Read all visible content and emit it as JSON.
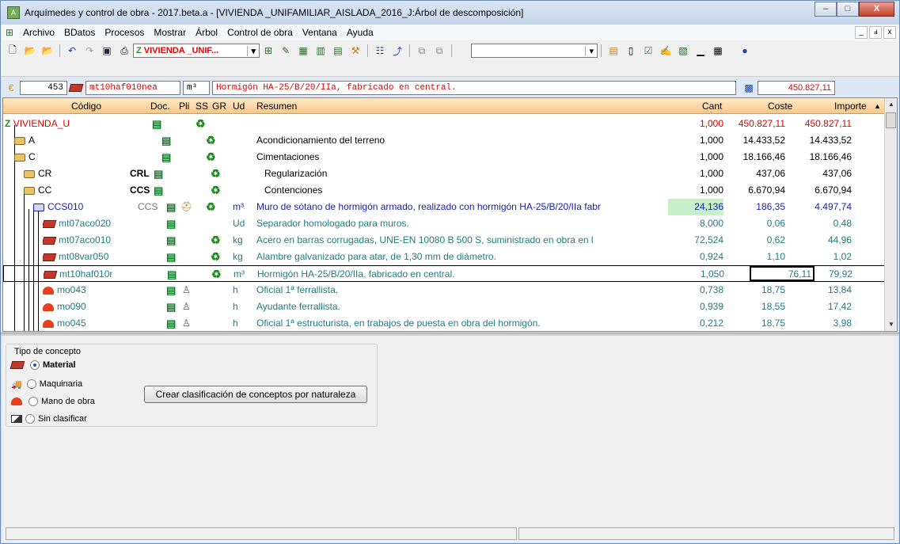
{
  "window": {
    "title": "Arquímedes y control de obra - 2017.beta.a - [VIVIENDA _UNIFAMILIAR_AISLADA_2016_J:Árbol de descomposición]",
    "controls": [
      "–",
      "□",
      "X"
    ]
  },
  "menu": {
    "items": [
      "Archivo",
      "BDatos",
      "Procesos",
      "Mostrar",
      "Árbol",
      "Control de obra",
      "Ventana",
      "Ayuda"
    ],
    "mdi_controls": [
      "_",
      "ⅎ",
      "x"
    ]
  },
  "toolbar": {
    "project_combo": "VIVIENDA _UNIF...",
    "empty_combo": ""
  },
  "infobar": {
    "count": "453",
    "code": "mt10haf010nea",
    "unit": "m³",
    "summary": "Hormigón HA-25/B/20/IIa, fabricado en central.",
    "total": "450.827,11"
  },
  "grid": {
    "headers": {
      "codigo": "Código",
      "doc": "Doc.",
      "pli": "Pli",
      "ss": "SS",
      "gr": "GR",
      "ud": "Ud",
      "resumen": "Resumen",
      "cant": "Cant",
      "coste": "Coste",
      "importe": "Importe"
    },
    "rows": [
      {
        "code": "VIVIENDA_U",
        "code2": "",
        "ud": "",
        "resumen": "",
        "cant": "1,000",
        "coste": "450.827,11",
        "importe": "450.827,11"
      },
      {
        "code": "A",
        "code2": "",
        "ud": "",
        "resumen": "Acondicionamiento del terreno",
        "cant": "1,000",
        "coste": "14.433,52",
        "importe": "14.433,52"
      },
      {
        "code": "C",
        "code2": "",
        "ud": "",
        "resumen": "Cimentaciones",
        "cant": "1,000",
        "coste": "18.166,46",
        "importe": "18.166,46"
      },
      {
        "code": "CR",
        "code2": "CRL",
        "ud": "",
        "resumen": "Regularización",
        "cant": "1,000",
        "coste": "437,06",
        "importe": "437,06"
      },
      {
        "code": "CC",
        "code2": "CCS",
        "ud": "",
        "resumen": "Contenciones",
        "cant": "1,000",
        "coste": "6.670,94",
        "importe": "6.670,94"
      },
      {
        "code": "CCS010",
        "code2": "CCS",
        "ud": "m³",
        "resumen": "Muro de sótano de hormigón armado, realizado con hormigón HA-25/B/20/IIa fabr",
        "cant": "24,136",
        "coste": "186,35",
        "importe": "4.497,74"
      },
      {
        "code": "mt07aco020",
        "code2": "",
        "ud": "Ud",
        "resumen": "Separador homologado para muros.",
        "cant": "8,000",
        "coste": "0,06",
        "importe": "0,48"
      },
      {
        "code": "mt07aco010",
        "code2": "",
        "ud": "kg",
        "resumen": "Acero en barras corrugadas, UNE-EN 10080 B 500 S, suministrado en obra en l",
        "cant": "72,524",
        "coste": "0,62",
        "importe": "44,96"
      },
      {
        "code": "mt08var050",
        "code2": "",
        "ud": "kg",
        "resumen": "Alambre galvanizado para atar, de 1,30 mm de diámetro.",
        "cant": "0,924",
        "coste": "1,10",
        "importe": "1,02"
      },
      {
        "code": "mt10haf010r",
        "code2": "",
        "ud": "m³",
        "resumen": "Hormigón HA-25/B/20/IIa, fabricado en central.",
        "cant": "1,050",
        "coste": "76,11",
        "importe": "79,92"
      },
      {
        "code": "mo043",
        "code2": "",
        "ud": "h",
        "resumen": "Oficial 1ª ferrallista.",
        "cant": "0,738",
        "coste": "18,75",
        "importe": "13,84"
      },
      {
        "code": "mo090",
        "code2": "",
        "ud": "h",
        "resumen": "Ayudante ferrallista.",
        "cant": "0,939",
        "coste": "18,55",
        "importe": "17,42"
      },
      {
        "code": "mo045",
        "code2": "",
        "ud": "h",
        "resumen": "Oficial 1ª estructurista, en trabajos de puesta en obra del hormigón.",
        "cant": "0,212",
        "coste": "18,75",
        "importe": "3,98"
      }
    ]
  },
  "concept_panel": {
    "legend": "Tipo de concepto",
    "options": [
      "Material",
      "Maquinaria",
      "Mano de obra",
      "Sin clasificar"
    ],
    "selected": "Material",
    "button": "Crear clasificación de conceptos por naturaleza"
  },
  "colors": {
    "header_bg": "#f9c88b",
    "root_red": "#e00000",
    "concept_blue": "#1a22a8",
    "material_teal": "#247a85",
    "highlight_cell": "#c8f0c8"
  }
}
